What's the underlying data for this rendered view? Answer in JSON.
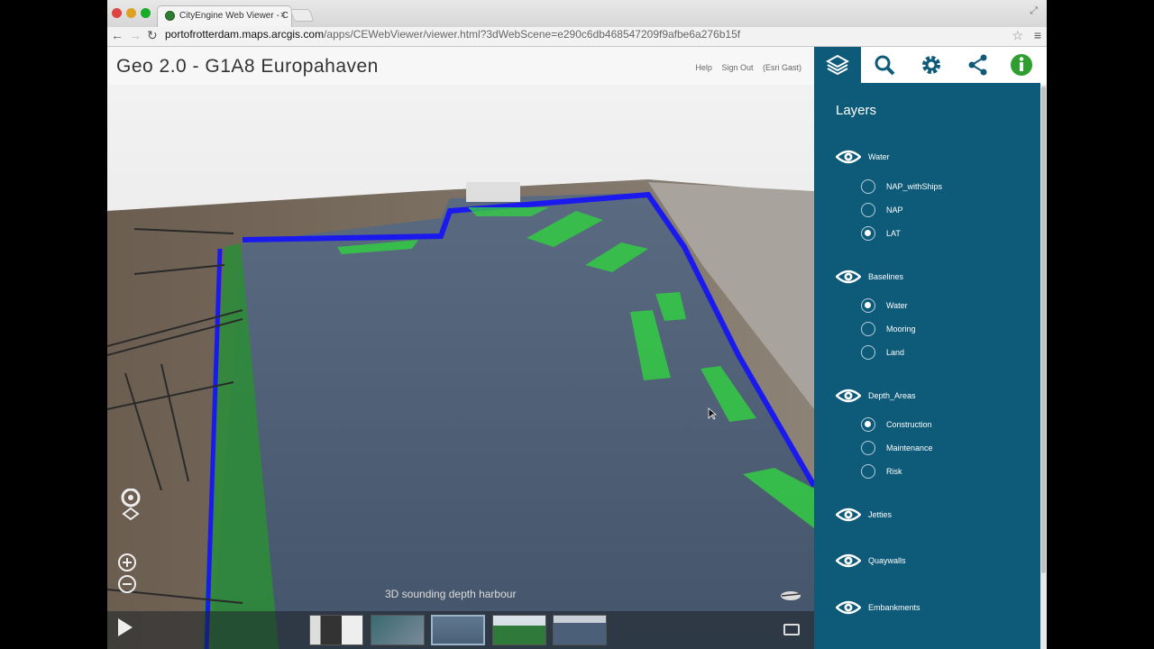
{
  "browser": {
    "tab_title": "CityEngine Web Viewer - C",
    "url_domain": "portofrotterdam.maps.arcgis.com",
    "url_path": "/apps/CEWebViewer/viewer.html?3dWebScene=e290c6db468547209f9afbe6a276b15f"
  },
  "header": {
    "title": "Geo 2.0 - G1A8 Europahaven",
    "links": [
      "Help",
      "Sign Out",
      "(Esri Gast)"
    ]
  },
  "sidebar": {
    "tabs": [
      {
        "icon": "layers-icon",
        "active": true
      },
      {
        "icon": "search-icon",
        "active": false
      },
      {
        "icon": "gear-icon",
        "active": false
      },
      {
        "icon": "share-icon",
        "active": false
      },
      {
        "icon": "info-icon",
        "active": false
      }
    ],
    "panel_title": "Layers",
    "layers": [
      {
        "name": "Water",
        "options": [
          {
            "label": "NAP_withShips",
            "selected": false
          },
          {
            "label": "NAP",
            "selected": false
          },
          {
            "label": "LAT",
            "selected": true
          }
        ]
      },
      {
        "name": "Baselines",
        "options": [
          {
            "label": "Water",
            "selected": true
          },
          {
            "label": "Mooring",
            "selected": false
          },
          {
            "label": "Land",
            "selected": false
          }
        ]
      },
      {
        "name": "Depth_Areas",
        "options": [
          {
            "label": "Construction",
            "selected": true
          },
          {
            "label": "Maintenance",
            "selected": false
          },
          {
            "label": "Risk",
            "selected": false
          }
        ]
      },
      {
        "name": "Jetties",
        "options": []
      },
      {
        "name": "Quaywalls",
        "options": []
      },
      {
        "name": "Embankments",
        "options": []
      }
    ]
  },
  "viewport": {
    "caption": "3D sounding depth harbour",
    "active_thumbnail": 3
  },
  "colors": {
    "sidebar_bg": "#0e5a79",
    "water": "#4a5d78",
    "depth_green": "#33cc44",
    "quay_blue": "#1a1aee"
  }
}
